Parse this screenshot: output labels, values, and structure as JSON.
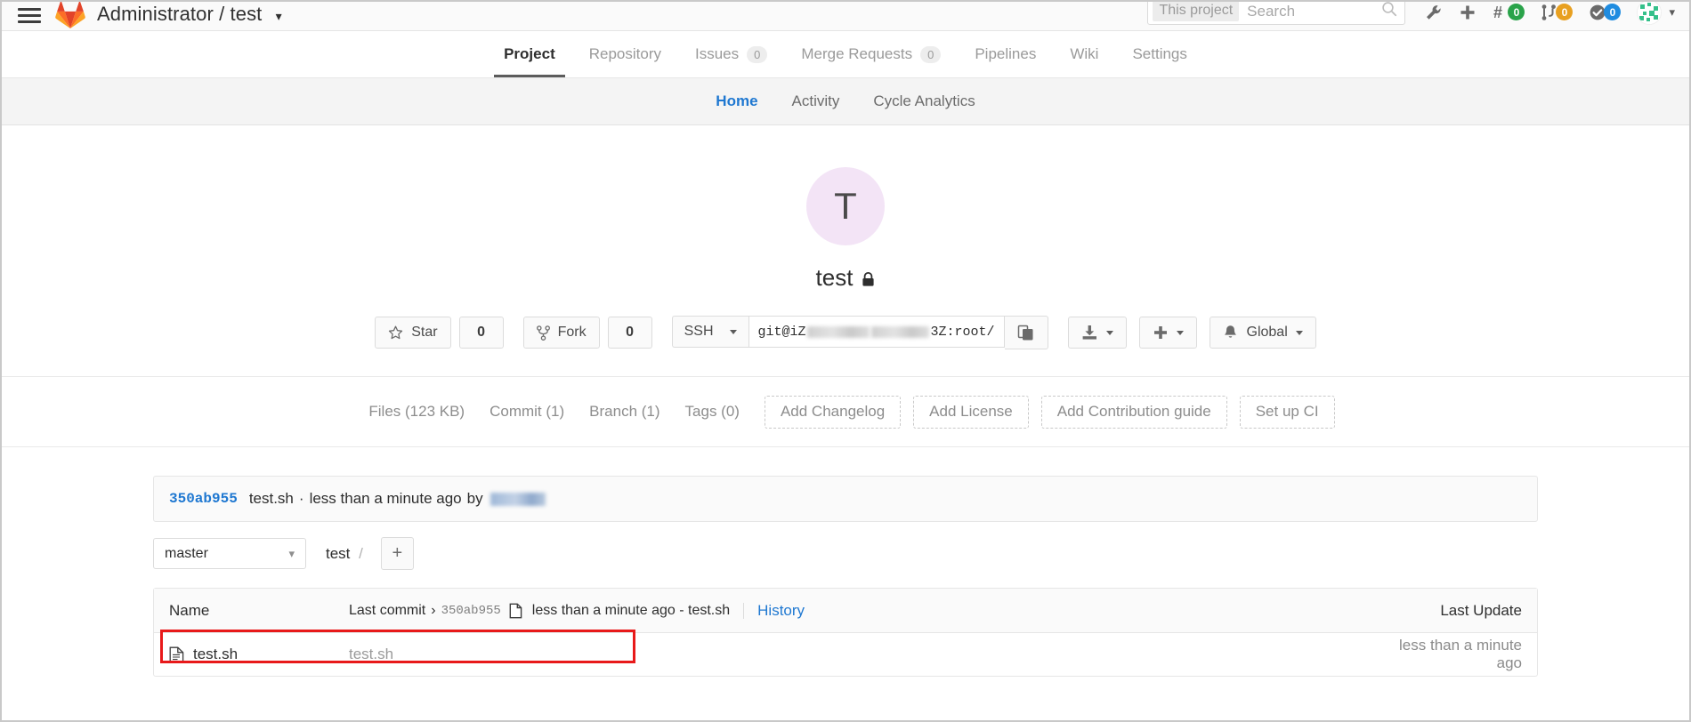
{
  "header": {
    "hamburger_label": "menu",
    "brand": "Administrator / test",
    "search": {
      "scope": "This project",
      "placeholder": "Search"
    },
    "icons": [
      {
        "name": "admin-wrench",
        "badge": null
      },
      {
        "name": "new-plus",
        "badge": null
      },
      {
        "name": "issues-hash",
        "badge": "0",
        "badge_color": "#2aa34a"
      },
      {
        "name": "merge-requests",
        "badge": "0",
        "badge_color": "#e8a020"
      },
      {
        "name": "todos-check",
        "badge": "0",
        "badge_color": "#1f8ce0"
      }
    ]
  },
  "main_nav": [
    {
      "label": "Project",
      "badge": null,
      "active": true
    },
    {
      "label": "Repository",
      "badge": null,
      "active": false
    },
    {
      "label": "Issues",
      "badge": "0",
      "active": false
    },
    {
      "label": "Merge Requests",
      "badge": "0",
      "active": false
    },
    {
      "label": "Pipelines",
      "badge": null,
      "active": false
    },
    {
      "label": "Wiki",
      "badge": null,
      "active": false
    },
    {
      "label": "Settings",
      "badge": null,
      "active": false
    }
  ],
  "sub_nav": [
    {
      "label": "Home",
      "active": true
    },
    {
      "label": "Activity",
      "active": false
    },
    {
      "label": "Cycle Analytics",
      "active": false
    }
  ],
  "project": {
    "avatar_letter": "T",
    "avatar_bg": "#f3e4f6",
    "name": "test",
    "visibility": "private",
    "star_label": "Star",
    "star_count": "0",
    "fork_label": "Fork",
    "fork_count": "0",
    "clone_protocol": "SSH",
    "clone_url_prefix": "git@iZ",
    "clone_url_suffix": "3Z:root/",
    "notification_label": "Global"
  },
  "stats": [
    {
      "label": "Files (123 KB)"
    },
    {
      "label": "Commit (1)"
    },
    {
      "label": "Branch (1)"
    },
    {
      "label": "Tags (0)"
    }
  ],
  "quick_actions": [
    {
      "label": "Add Changelog"
    },
    {
      "label": "Add License"
    },
    {
      "label": "Add Contribution guide"
    },
    {
      "label": "Set up CI"
    }
  ],
  "commit_bar": {
    "sha": "350ab955",
    "message": "test.sh",
    "separator": "·",
    "time": "less than a minute ago",
    "by_label": "by"
  },
  "repo_browser": {
    "branch": "master",
    "breadcrumb_root": "test",
    "breadcrumb_sep": "/",
    "add_button": "+"
  },
  "file_table": {
    "col_name": "Name",
    "last_commit_label": "Last commit",
    "last_commit_arrow": "›",
    "last_commit_sha": "350ab955",
    "last_commit_msg": "less than a minute ago - test.sh",
    "history_label": "History",
    "col_last_update": "Last Update",
    "rows": [
      {
        "icon": "file-icon",
        "name": "test.sh",
        "commit_message": "test.sh",
        "last_update": "less than a minute ago",
        "highlighted": true
      }
    ]
  }
}
